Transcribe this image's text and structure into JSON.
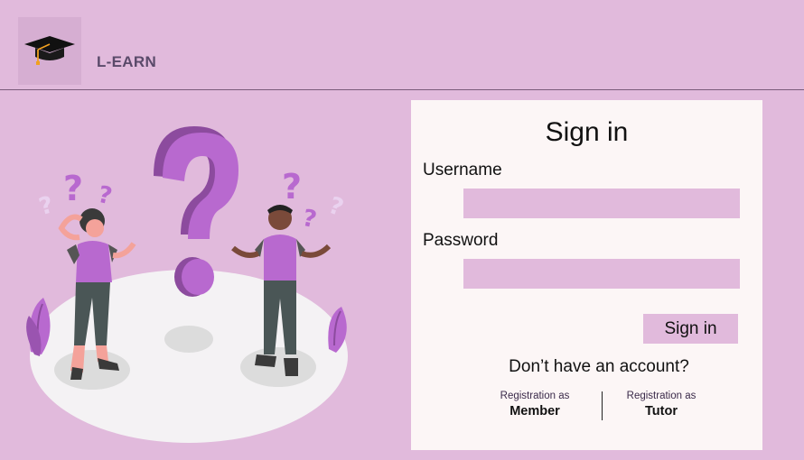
{
  "header": {
    "brand": "L-EARN",
    "logo_icon": "graduation-cap-icon"
  },
  "illustration": {
    "description_icon": "confused-people-illustration"
  },
  "signin": {
    "title": "Sign in",
    "username_label": "Username",
    "username_value": "",
    "password_label": "Password",
    "password_value": "",
    "button_label": "Sign in",
    "no_account_text": "Don’t have an account?",
    "register_member": {
      "small": "Registration as",
      "big": "Member"
    },
    "register_tutor": {
      "small": "Registration as",
      "big": "Tutor"
    }
  },
  "colors": {
    "background": "#e1badc",
    "panel": "#fcf6f6",
    "field": "#e1badc",
    "accent_purple": "#b869cf"
  }
}
